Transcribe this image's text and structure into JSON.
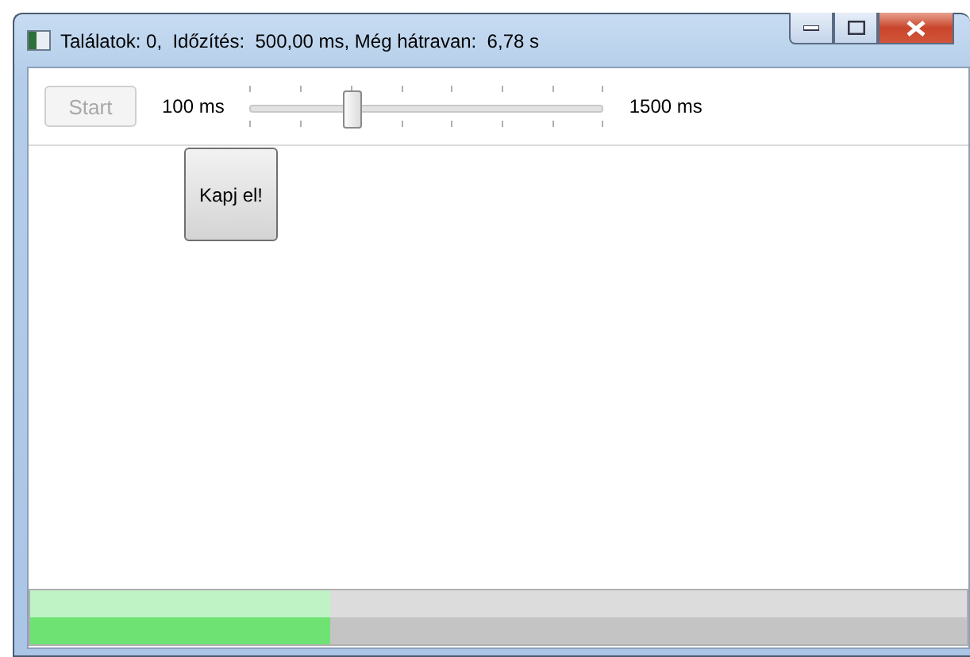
{
  "window": {
    "title": "Találatok: 0,  Időzítés:  500,00 ms, Még hátravan:  6,78 s"
  },
  "toolbar": {
    "start_button": {
      "label": "Start",
      "disabled": true
    },
    "slider": {
      "min_label": "100 ms",
      "max_label": "1500 ms",
      "level": 0.286
    }
  },
  "game_area": {
    "target_button": {
      "label": "Kapj el!"
    }
  },
  "progress": {
    "level": 0.32
  }
}
